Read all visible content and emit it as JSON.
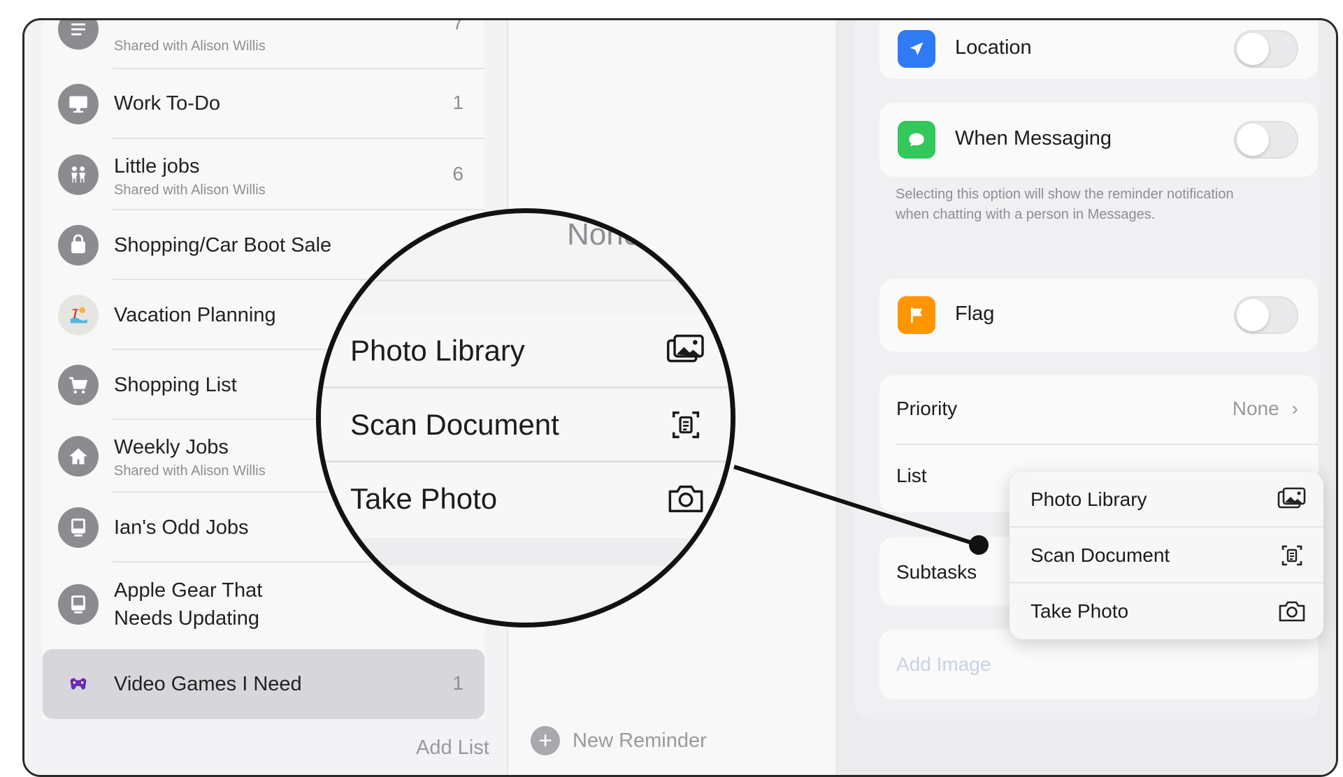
{
  "sidebar": {
    "lists": [
      {
        "name": "",
        "subtitle": "Shared with Alison Willis",
        "count": "7",
        "icon": "list-icon"
      },
      {
        "name": "Work To-Do",
        "subtitle": "",
        "count": "1",
        "icon": "desktop-icon"
      },
      {
        "name": "Little jobs",
        "subtitle": "Shared with Alison Willis",
        "count": "6",
        "icon": "people-icon"
      },
      {
        "name": "Shopping/Car Boot Sale",
        "subtitle": "",
        "count": "",
        "icon": "bag-icon"
      },
      {
        "name": "Vacation Planning",
        "subtitle": "",
        "count": "",
        "icon": "beach-icon"
      },
      {
        "name": "Shopping List",
        "subtitle": "",
        "count": "",
        "icon": "cart-icon"
      },
      {
        "name": "Weekly Jobs",
        "subtitle": "Shared with Alison Willis",
        "count": "",
        "icon": "house-icon"
      },
      {
        "name": "Ian's Odd Jobs",
        "subtitle": "",
        "count": "",
        "icon": "computer-icon"
      },
      {
        "name": "Apple Gear That\nNeeds Updating",
        "subtitle": "",
        "count": "",
        "icon": "computer-icon"
      },
      {
        "name": "Video Games I Need",
        "subtitle": "",
        "count": "1",
        "icon": "game-icon"
      }
    ],
    "add_list": "Add List"
  },
  "middle": {
    "new_reminder": "New Reminder"
  },
  "details": {
    "location_label": "Location",
    "messaging_label": "When Messaging",
    "messaging_footnote": "Selecting this option will show the reminder notification when chatting with a person in Messages.",
    "flag_label": "Flag",
    "priority_label": "Priority",
    "priority_value": "None",
    "list_label": "List",
    "subtasks_label": "Subtasks",
    "add_image_label": "Add Image",
    "toggles": {
      "location": false,
      "messaging": false,
      "flag": false
    },
    "colors": {
      "location": "#2f7bf6",
      "messaging": "#34c759",
      "flag": "#ff9500"
    }
  },
  "popover": {
    "items": [
      {
        "label": "Photo Library",
        "icon": "photo-library-icon"
      },
      {
        "label": "Scan Document",
        "icon": "scan-document-icon"
      },
      {
        "label": "Take Photo",
        "icon": "camera-icon"
      }
    ]
  },
  "magnifier": {
    "none_text": "None",
    "items": [
      {
        "label": "Photo Library",
        "icon": "photo-library-icon"
      },
      {
        "label": "Scan Document",
        "icon": "scan-document-icon"
      },
      {
        "label": "Take Photo",
        "icon": "camera-icon"
      }
    ]
  }
}
